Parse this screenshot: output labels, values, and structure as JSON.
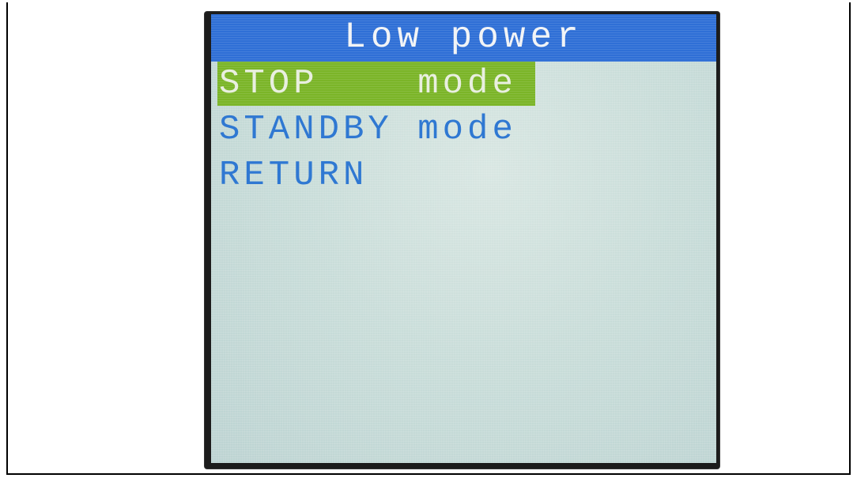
{
  "screen": {
    "title": "Low power",
    "menu": {
      "items": [
        {
          "label": "STOP    mode",
          "selected": true
        },
        {
          "label": "STANDBY mode",
          "selected": false
        },
        {
          "label": "RETURN",
          "selected": false
        }
      ]
    }
  },
  "colors": {
    "title_bar": "#2f6fd6",
    "selected_item_bg": "#7bb528",
    "item_text": "#2f78d2",
    "screen_bg": "#c9ddd9"
  }
}
